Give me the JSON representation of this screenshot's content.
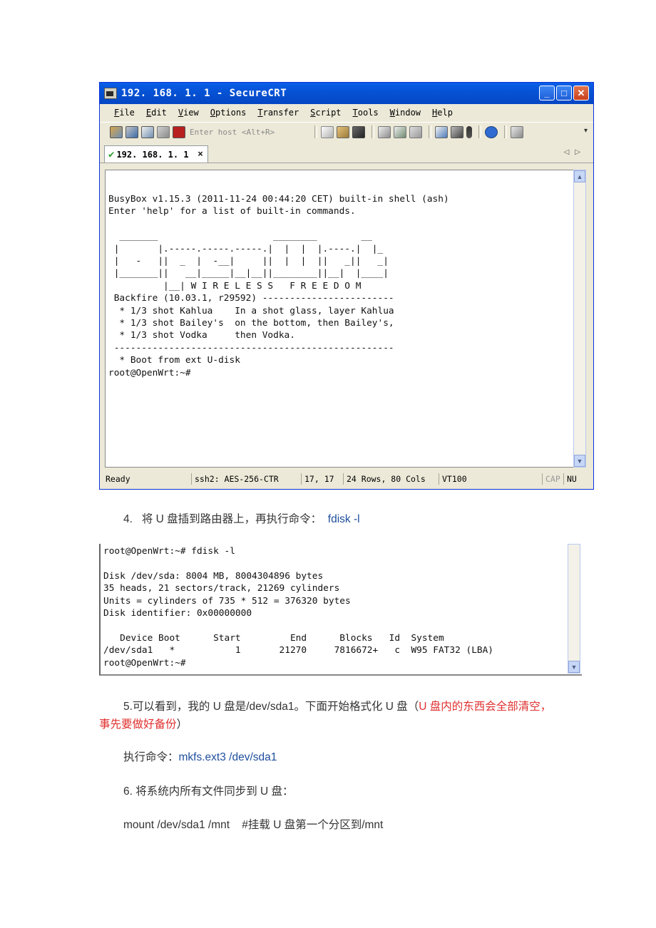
{
  "window": {
    "title": "192. 168. 1. 1  -  SecureCRT",
    "controls": [
      "_",
      "□",
      "✕"
    ]
  },
  "menu": [
    "File",
    "Edit",
    "View",
    "Options",
    "Transfer",
    "Script",
    "Tools",
    "Window",
    "Help"
  ],
  "toolbar": {
    "host_placeholder": "Enter host <Alt+R>"
  },
  "tab": {
    "label": "192. 168. 1. 1"
  },
  "terminal": {
    "text": "BusyBox v1.15.3 (2011-11-24 00:44:20 CET) built-in shell (ash)\nEnter 'help' for a list of built-in commands.\n\n  _______                     ________        __\n |       |.-----.-----.-----.|  |  |  |.----.|  |_\n |   -   ||  _  |  -__|     ||  |  |  ||   _||   _|\n |_______||   __|_____|__|__||________||__|  |____|\n          |__| W I R E L E S S   F R E E D O M\n Backfire (10.03.1, r29592) ------------------------\n  * 1/3 shot Kahlua    In a shot glass, layer Kahlua\n  * 1/3 shot Bailey's  on the bottom, then Bailey's,\n  * 1/3 shot Vodka     then Vodka.\n ---------------------------------------------------\n  * Boot from ext U-disk\nroot@OpenWrt:~#"
  },
  "status": {
    "ready": "Ready",
    "cipher": "ssh2: AES-256-CTR",
    "position": "17,   17",
    "size": "24 Rows,  80 Cols",
    "emulation": "VT100",
    "cap": "CAP",
    "num": "NU"
  },
  "article": {
    "step4_num": "4.",
    "step4_text": "将 U 盘插到路由器上，再执行命令：",
    "step4_cmd": "fdisk -l",
    "step5_line1_a": "5.可以看到，我的 U 盘是/dev/sda1。下面开始格式化 U 盘（",
    "step5_line1_warn": "U 盘内的东西会全部清空，",
    "step5_line2_warn": "事先要做好备份",
    "step5_line2_end": "）",
    "exec_label": "执行命令：",
    "exec_cmd": "mkfs.ext3 /dev/sda1",
    "step6": "6. 将系统内所有文件同步到 U 盘：",
    "mount_line": "mount /dev/sda1 /mnt    #挂载 U 盘第一个分区到/mnt"
  },
  "fdisk_terminal": {
    "text": "root@OpenWrt:~# fdisk -l\n\nDisk /dev/sda: 8004 MB, 8004304896 bytes\n35 heads, 21 sectors/track, 21269 cylinders\nUnits = cylinders of 735 * 512 = 376320 bytes\nDisk identifier: 0x00000000\n\n   Device Boot      Start         End      Blocks   Id  System\n/dev/sda1   *           1       21270     7816672+   c  W95 FAT32 (LBA)\nroot@OpenWrt:~#"
  }
}
